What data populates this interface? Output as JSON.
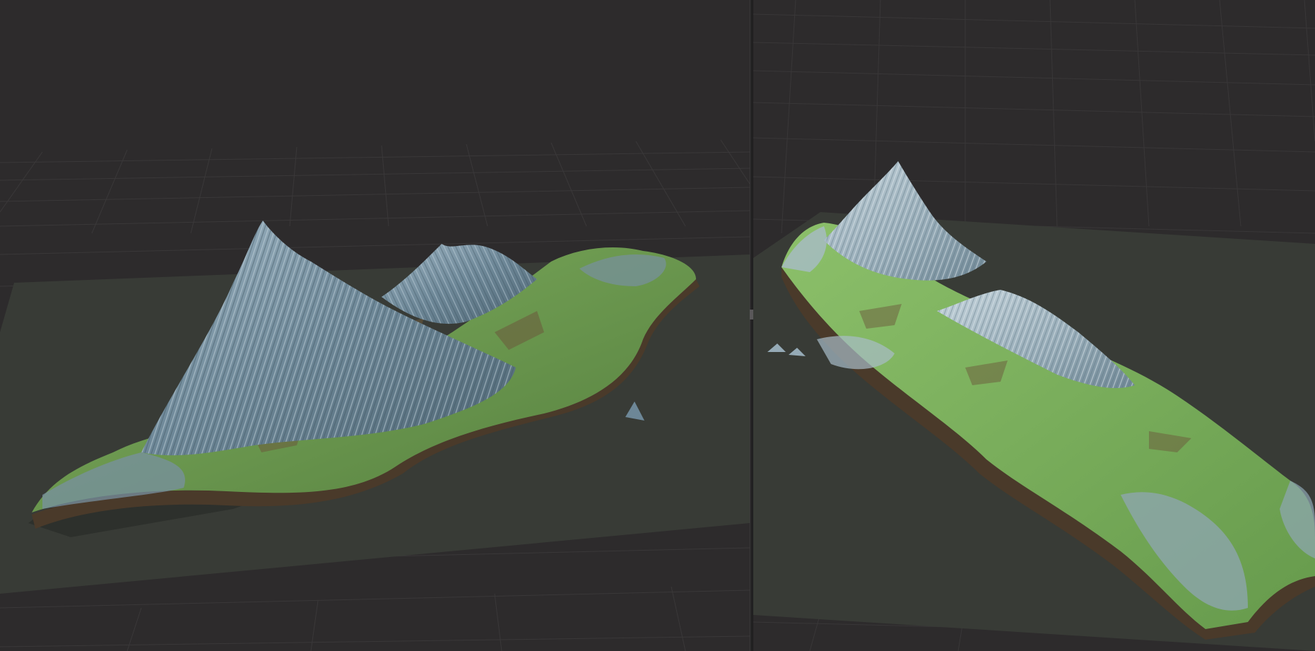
{
  "scene": {
    "background_color": "#2d2b2c",
    "grid_color": "#3a3839",
    "ground_color": "#383b36",
    "rock_color": "#7d97a8",
    "grass_color": "#6e9a52",
    "soil_color": "#6b5a3c"
  },
  "viewports": [
    {
      "id": "left",
      "model": "island-terrain",
      "view": "perspective"
    },
    {
      "id": "right",
      "model": "island-terrain",
      "view": "perspective"
    }
  ]
}
